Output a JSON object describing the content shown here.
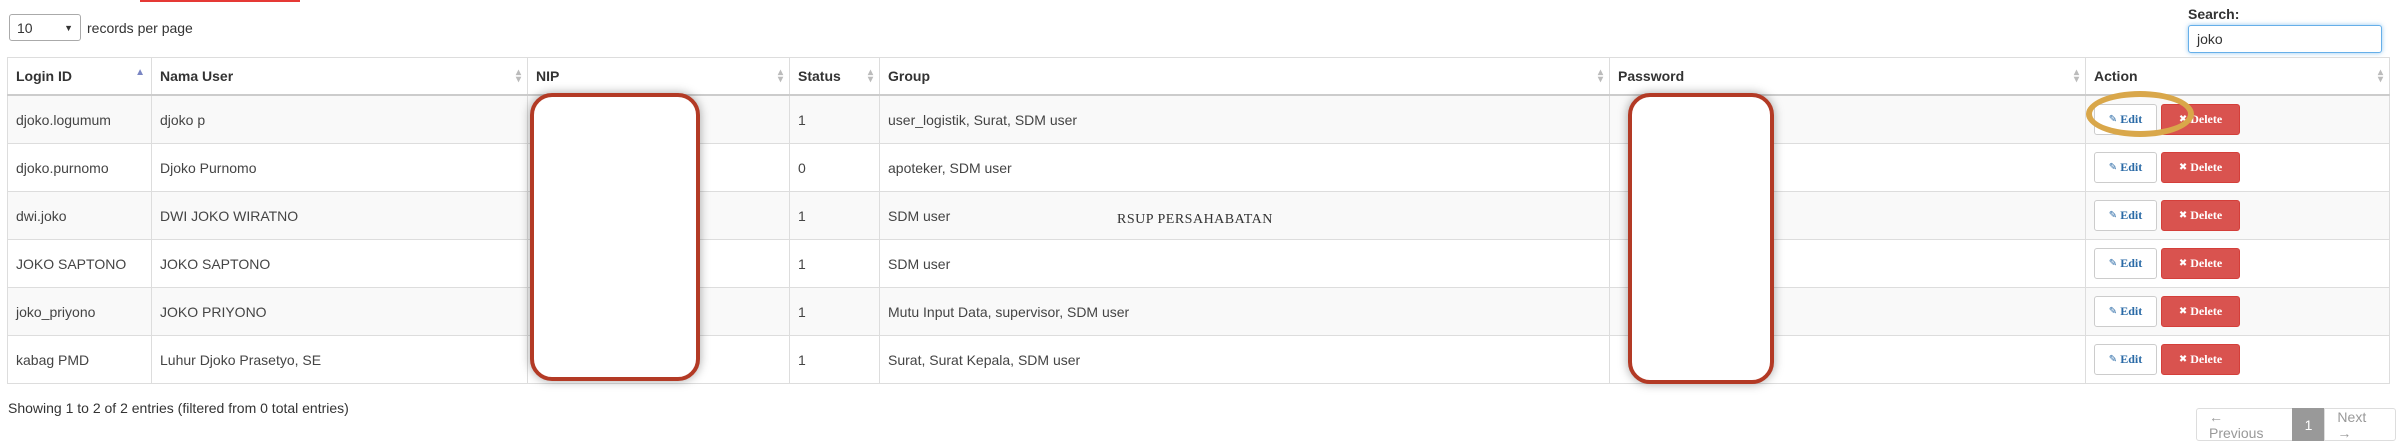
{
  "length_menu": {
    "selected": "10",
    "suffix": "records per page"
  },
  "search": {
    "label": "Search:",
    "value": "joko"
  },
  "columns": [
    "Login ID",
    "Nama User",
    "NIP",
    "Status",
    "Group",
    "Password",
    "Action"
  ],
  "rows": [
    {
      "login": "djoko.logumum",
      "nama": "djoko p",
      "status": "1",
      "group": "user_logistik, Surat, SDM user",
      "edit": "Edit",
      "delete": "Delete"
    },
    {
      "login": "djoko.purnomo",
      "nama": "Djoko Purnomo",
      "status": "0",
      "group": "apoteker, SDM user",
      "edit": "Edit",
      "delete": "Delete"
    },
    {
      "login": "dwi.joko",
      "nama": "DWI JOKO WIRATNO",
      "status": "1",
      "group": "SDM user",
      "edit": "Edit",
      "delete": "Delete"
    },
    {
      "login": "JOKO SAPTONO",
      "nama": "JOKO SAPTONO",
      "status": "1",
      "group": "SDM user",
      "edit": "Edit",
      "delete": "Delete"
    },
    {
      "login": "joko_priyono",
      "nama": "JOKO PRIYONO",
      "status": "1",
      "group": "Mutu Input Data, supervisor, SDM user",
      "edit": "Edit",
      "delete": "Delete"
    },
    {
      "login": "kabag PMD",
      "nama": "Luhur Djoko Prasetyo, SE",
      "status": "1",
      "group": "Surat, Surat Kepala, SDM user",
      "edit": "Edit",
      "delete": "Delete"
    }
  ],
  "watermark": "RSUP PERSAHABATAN",
  "info": "Showing 1 to 2 of 2 entries (filtered from 0 total entries)",
  "pagination": {
    "previous": "← Previous",
    "current": "1",
    "next": "Next →"
  },
  "colors": {
    "delete": "#d9534f",
    "edit_text": "#2a6aa6",
    "highlight": "#d9a74a",
    "redaction_border": "#b33a25",
    "focus": "#66afe9"
  },
  "icons": {
    "edit": "pencil-icon",
    "delete": "x-icon"
  }
}
